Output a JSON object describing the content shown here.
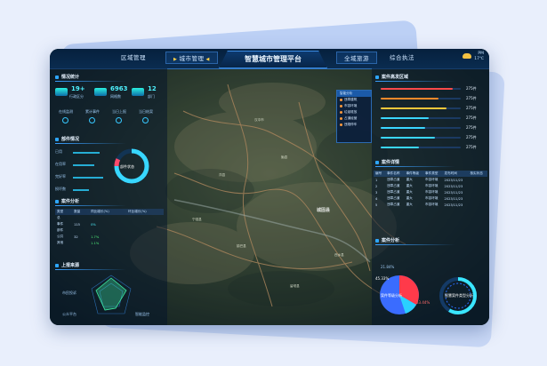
{
  "header": {
    "title": "智慧城市管理平台",
    "nav_left": [
      "区域管理",
      "城市管理"
    ],
    "nav_right": [
      "全域旅游",
      "综合执法"
    ],
    "weather": {
      "line1": "PM",
      "line2": "17℃"
    }
  },
  "left_panels": {
    "stats": {
      "title": "情况统计",
      "items": [
        {
          "value": "19+",
          "label": "行政区分"
        },
        {
          "value": "6963",
          "label": "网格数"
        },
        {
          "value": "12",
          "label": "部门"
        }
      ],
      "row_labels": [
        "在线监测",
        "累计事件",
        "当日上报",
        "当日结案"
      ]
    },
    "dept": {
      "title": "部件情况",
      "ring_label": "部件状态",
      "rows": [
        "已用",
        "在用率",
        "完好率",
        "损坏数"
      ],
      "ring_percent": 0.75
    },
    "cases": {
      "title": "案件分析",
      "columns": [
        "类型",
        "数量",
        "同比增长(%)",
        "环比增长(%)"
      ],
      "rows": [
        [
          "总",
          "",
          "",
          ""
        ],
        [
          "事件",
          "115",
          "0%",
          ""
        ],
        [
          "部件",
          "",
          "",
          ""
        ],
        [
          "公共",
          "32",
          "1.7%",
          ""
        ],
        [
          "其他",
          "",
          "1.1%",
          ""
        ]
      ]
    },
    "source": {
      "title": "上报来源",
      "labels": [
        "市民投诉",
        "公众平台",
        "智能监控"
      ]
    }
  },
  "right_panels": {
    "zones": {
      "title": "案件高发区域",
      "values": [
        "275件",
        "275件",
        "275件",
        "275件",
        "275件",
        "275件",
        "275件"
      ],
      "bar_values": [
        0.9,
        0.72,
        0.82,
        0.6,
        0.55,
        0.68,
        0.48
      ],
      "colors": [
        "#ff4a4a",
        "#ff8a2a",
        "#ffc83a",
        "#3ad6ff",
        "#3ad6ff",
        "#3ad6ff",
        "#3ad6ff"
      ]
    },
    "detail": {
      "title": "案件详情",
      "columns": [
        "编号",
        "事件名称",
        "事件等级",
        "事件类型",
        "发布时间",
        "核实状态"
      ],
      "rows": [
        [
          "1",
          "违章占道",
          "重大",
          "市容环境",
          "2023/11/23",
          ""
        ],
        [
          "2",
          "违章占道",
          "重大",
          "市容环境",
          "2023/11/23",
          ""
        ],
        [
          "3",
          "违章占道",
          "重大",
          "市容环境",
          "2023/11/23",
          ""
        ],
        [
          "4",
          "违章占道",
          "重大",
          "市容环境",
          "2023/11/23",
          ""
        ],
        [
          "5",
          "违章占道",
          "重大",
          "市容环境",
          "2023/11/23",
          ""
        ]
      ]
    },
    "analysis": {
      "title": "案件分析",
      "pie_label": "案件等级分析",
      "ring_label": "智慧案件类型分析",
      "pct_labels": [
        "45.33%",
        "33.44%",
        "21.84%"
      ]
    }
  },
  "dropdown": {
    "items": [
      "智能分析",
      "违章建筑",
      "市容环境",
      "垃圾堆放",
      "占道经营",
      "违规停车"
    ]
  },
  "map_labels": [
    "汉中市",
    "城固县",
    "洋县",
    "勉县",
    "镇巴县",
    "西乡县",
    "宁强县",
    "留坝县"
  ],
  "colors": {
    "accent": "#2ea7ff",
    "cyan": "#4ff2ff",
    "alert": "#ff4a4a"
  }
}
